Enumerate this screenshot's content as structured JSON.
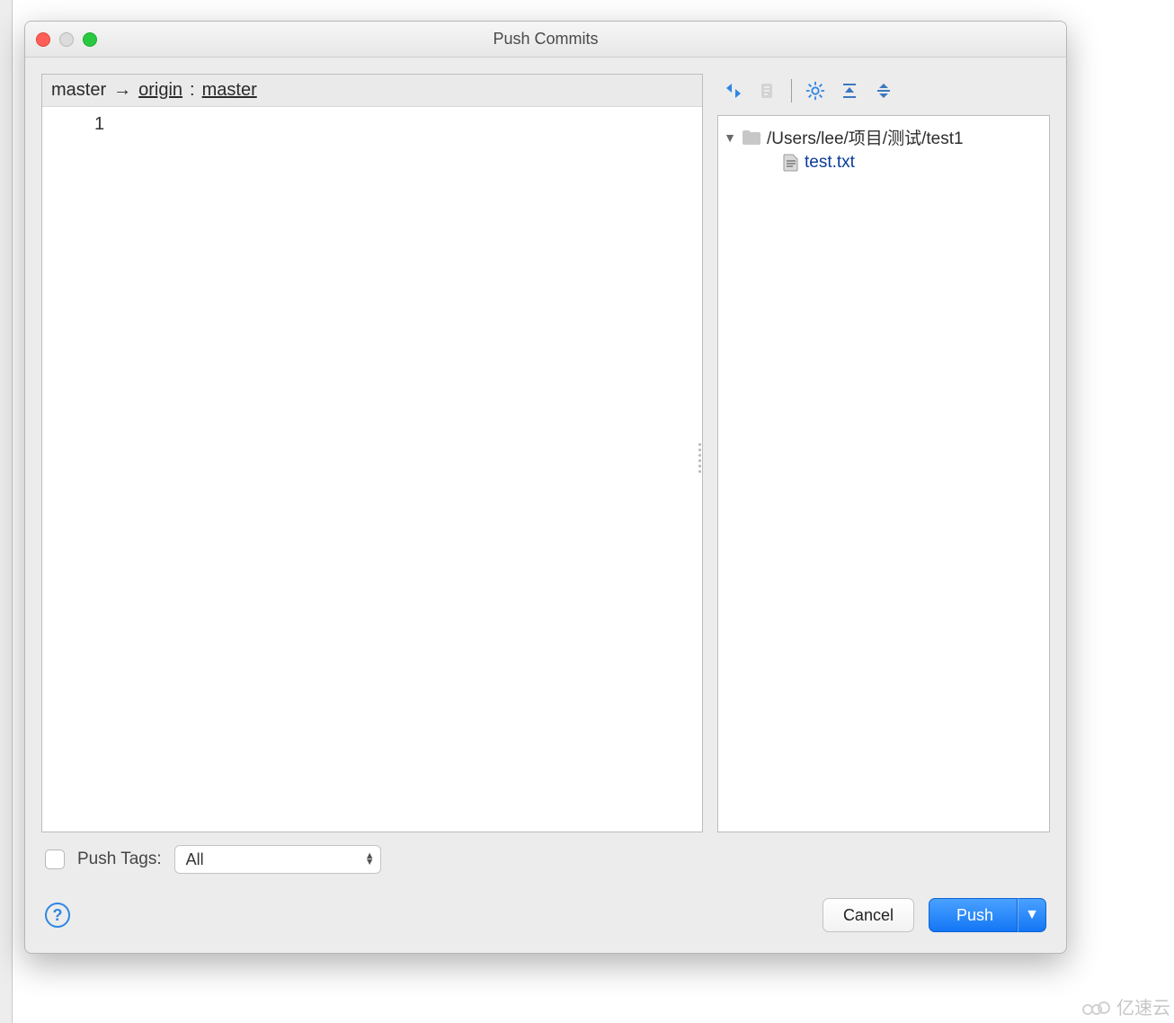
{
  "window": {
    "title": "Push Commits"
  },
  "branch": {
    "local": "master",
    "remote": "origin",
    "separator": ":",
    "remote_branch": "master"
  },
  "commits": [
    "1"
  ],
  "tree": {
    "root_path": "/Users/lee/项目/测试/test1",
    "files": [
      "test.txt"
    ]
  },
  "push_tags": {
    "label": "Push Tags:",
    "selected": "All"
  },
  "buttons": {
    "cancel": "Cancel",
    "push": "Push"
  },
  "watermark": "亿速云"
}
